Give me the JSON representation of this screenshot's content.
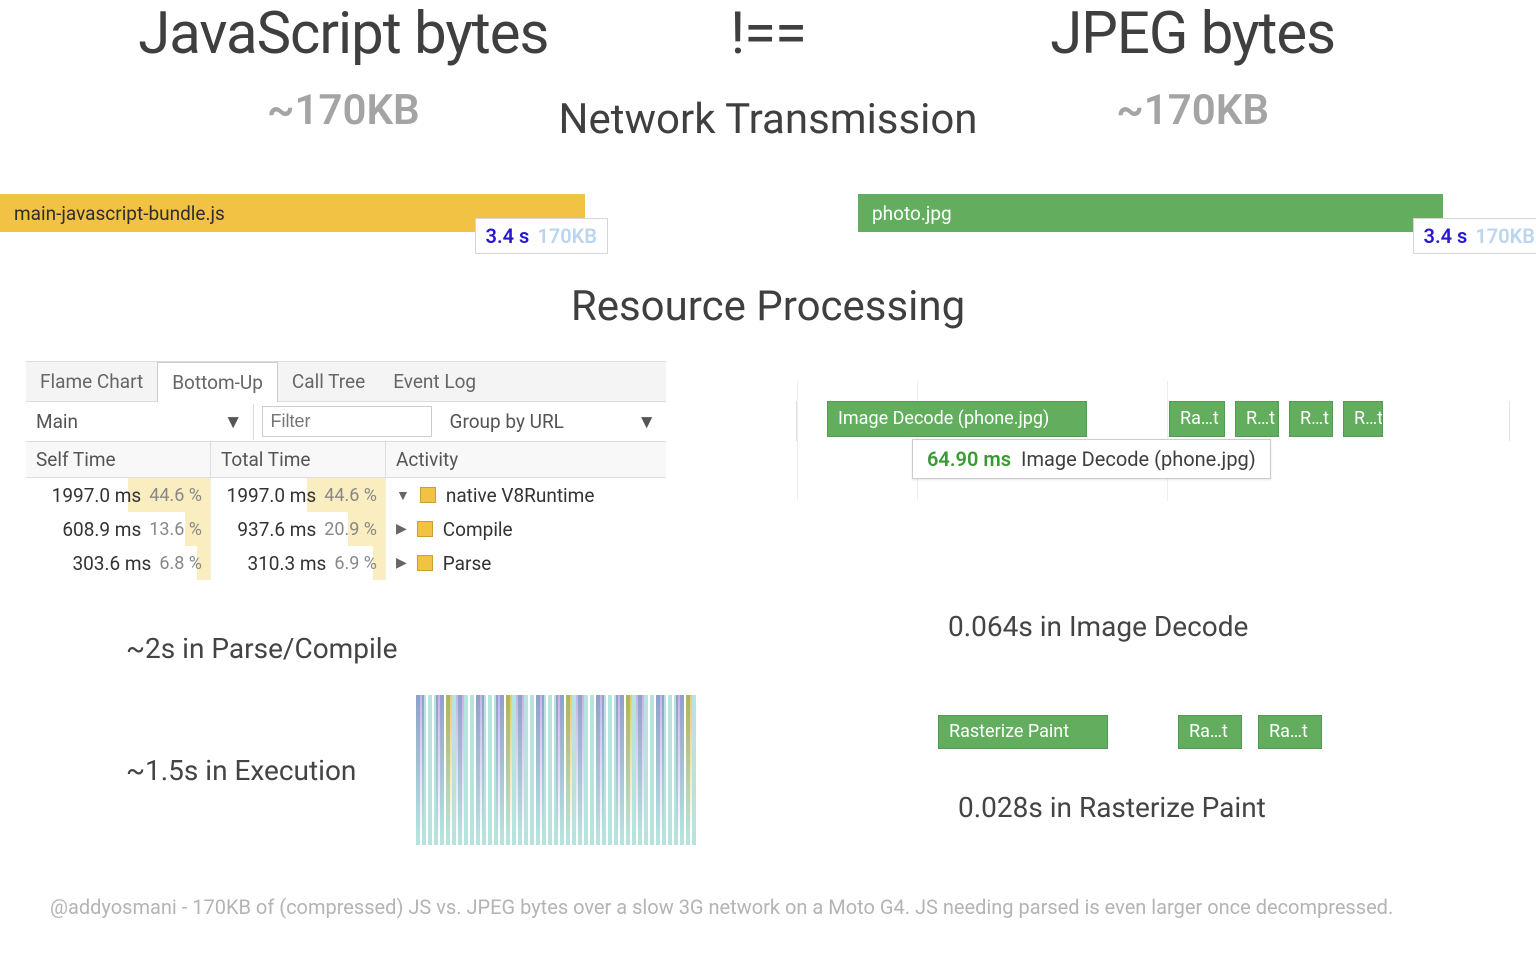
{
  "title_js": "JavaScript bytes",
  "title_neq": "!==",
  "title_jpeg": "JPEG bytes",
  "size_js": "~170KB",
  "size_jpeg": "~170KB",
  "section_network": "Network Transmission",
  "bar_js_file": "main-javascript-bundle.js",
  "bar_jpg_file": "photo.jpg",
  "badge_time": "3.4 s",
  "badge_size": "170KB",
  "section_processing": "Resource Processing",
  "tabs": {
    "flame": "Flame Chart",
    "bottom": "Bottom-Up",
    "calltree": "Call Tree",
    "eventlog": "Event Log"
  },
  "sel_main": "Main",
  "filter_placeholder": "Filter",
  "group_by": "Group by URL",
  "headers": {
    "self": "Self Time",
    "total": "Total Time",
    "activity": "Activity"
  },
  "rows": [
    {
      "self_ms": "1997.0 ms",
      "self_pct": "44.6 %",
      "self_w": 44.6,
      "total_ms": "1997.0 ms",
      "total_pct": "44.6 %",
      "total_w": 44.6,
      "act": "native V8Runtime",
      "tri": "▼"
    },
    {
      "self_ms": "608.9 ms",
      "self_pct": "13.6 %",
      "self_w": 13.6,
      "total_ms": "937.6 ms",
      "total_pct": "20.9 %",
      "total_w": 20.9,
      "act": "Compile",
      "tri": "▶"
    },
    {
      "self_ms": "303.6 ms",
      "self_pct": "6.8 %",
      "self_w": 6.8,
      "total_ms": "310.3 ms",
      "total_pct": "6.9 %",
      "total_w": 6.9,
      "act": "Parse",
      "tri": "▶"
    }
  ],
  "decode_block": "Image Decode (phone.jpg)",
  "decode_small": "Ra…t",
  "decode_small2": "R…t",
  "tooltip_ms": "64.90 ms",
  "tooltip_label": "Image Decode (phone.jpg)",
  "summary_js_parse": "~2s in Parse/Compile",
  "summary_img_decode": "0.064s in Image Decode",
  "summary_js_exec": "~1.5s in Execution",
  "raster_block": "Rasterize Paint",
  "summary_img_raster": "0.028s in Rasterize Paint",
  "footer": "@addyosmani - 170KB of (compressed) JS vs. JPEG bytes over a slow 3G network on a Moto G4. JS needing parsed is even larger once decompressed."
}
